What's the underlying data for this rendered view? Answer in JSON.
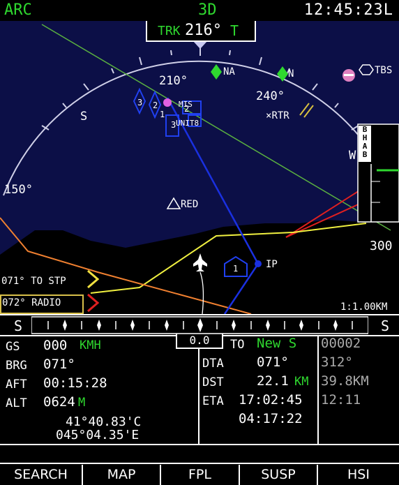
{
  "header": {
    "mode": "ARC",
    "view": "3D",
    "time": "12:45:23L"
  },
  "track": {
    "label": "TRK",
    "value": "216°",
    "ref": "T"
  },
  "compass": {
    "h210": "210°",
    "h240": "240°",
    "h150": "150°",
    "south": "S",
    "west": "W"
  },
  "waypoints": {
    "na": "NA",
    "n": "N",
    "tbs": "TBS",
    "rtr": "RTR",
    "red": "RED",
    "ip": "IP",
    "mis": "MIS",
    "unit": "UNIT8"
  },
  "contact_numbers": [
    "3",
    "2",
    "1",
    "3",
    "2",
    "1"
  ],
  "alt_scale": {
    "letters": [
      "B",
      "H",
      "A",
      "B"
    ],
    "value": "300"
  },
  "map_scale": "1:1.00KM",
  "steering": {
    "to_stp": "071° TO STP",
    "radio": "072° RADIO"
  },
  "hsi": {
    "left": "S",
    "right": "S",
    "center": "0.0"
  },
  "nav": {
    "gs_label": "GS",
    "gs_value": "000",
    "gs_unit": "KMH",
    "brg_label": "BRG",
    "brg_value": "071°",
    "aft_label": "AFT",
    "aft_value": "00:15:28",
    "alt_label": "ALT",
    "alt_value": "0624",
    "alt_unit": "M",
    "lat": "41°40.83'C",
    "lon": "045°04.35'E"
  },
  "dest": {
    "to_label": "TO",
    "to_name": "New S",
    "dta_label": "DTA",
    "dta_value": "071°",
    "dst_label": "DST",
    "dst_value": "22.1",
    "dst_unit": "KM",
    "eta_label": "ETA",
    "eta_value": "17:02:45",
    "ete_value": "04:17:22"
  },
  "next": {
    "wp": "00002",
    "course": "312°",
    "dist": "39.8KM",
    "time": "12:11"
  },
  "softkeys": [
    "SEARCH",
    "MAP",
    "FPL",
    "SUSP",
    "HSI"
  ],
  "colors": {
    "map_bg": "#0c0f47",
    "green": "#2fd82f",
    "route_yellow": "#f0f040",
    "route_blue": "#1a30e0"
  }
}
